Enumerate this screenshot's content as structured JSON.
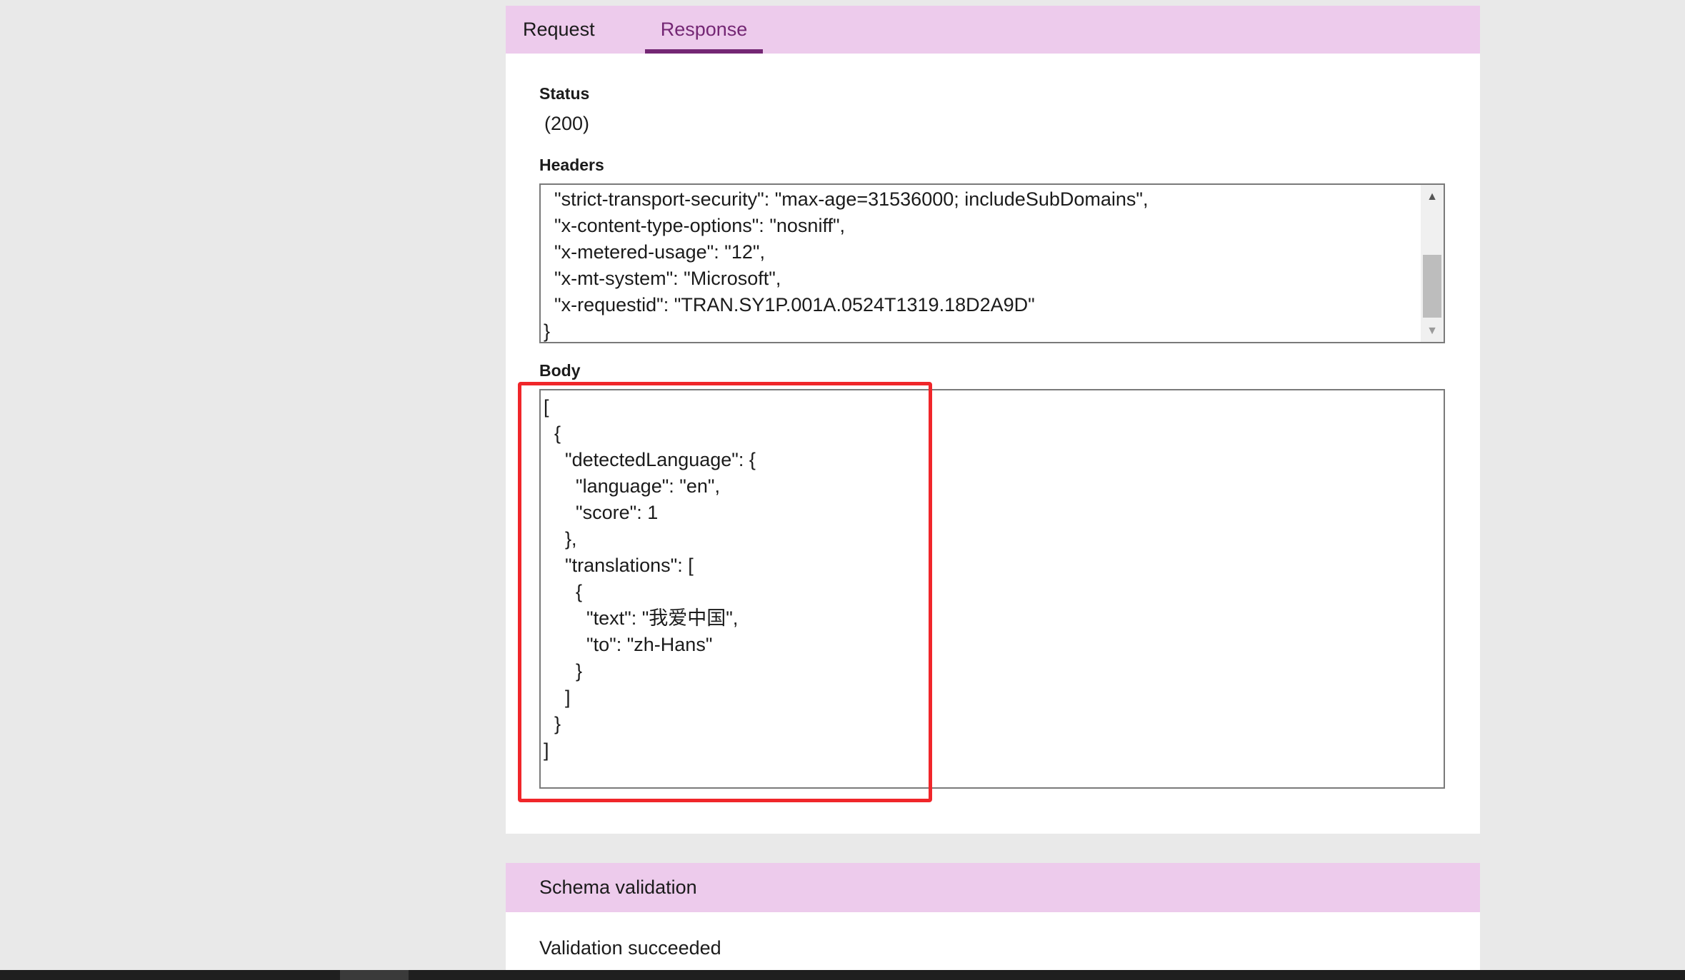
{
  "tabs": {
    "request_label": "Request",
    "response_label": "Response",
    "active": "Response"
  },
  "status": {
    "label": "Status",
    "value": "(200)"
  },
  "headers": {
    "label": "Headers",
    "lines": [
      "  \"strict-transport-security\": \"max-age=31536000; includeSubDomains\",",
      "  \"x-content-type-options\": \"nosniff\",",
      "  \"x-metered-usage\": \"12\",",
      "  \"x-mt-system\": \"Microsoft\",",
      "  \"x-requestid\": \"TRAN.SY1P.001A.0524T1319.18D2A9D\"",
      "}"
    ],
    "scroll_up_glyph": "▲",
    "scroll_down_glyph": "▼"
  },
  "body": {
    "label": "Body",
    "lines": [
      "[",
      "  {",
      "    \"detectedLanguage\": {",
      "      \"language\": \"en\",",
      "      \"score\": 1",
      "    },",
      "    \"translations\": [",
      "      {",
      "        \"text\": \"我爱中国\",",
      "        \"to\": \"zh-Hans\"",
      "      }",
      "    ]",
      "  }",
      "]"
    ]
  },
  "schema_validation": {
    "title": "Schema validation",
    "result": "Validation succeeded"
  },
  "colors": {
    "tab_bar_bg": "#edcbec",
    "active_tab_accent": "#742774",
    "highlight_border": "#f0262a",
    "page_bg": "#e9e9e9"
  }
}
